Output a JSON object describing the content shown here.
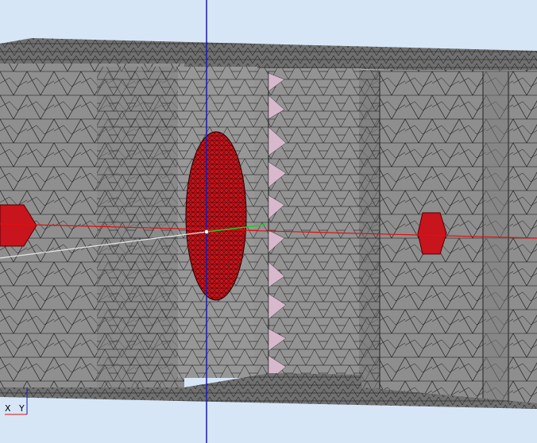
{
  "viewport": {
    "background_color": "#d6e6f7",
    "mesh_face_color": "#8c8c8c",
    "mesh_line_color": "#111111",
    "source_region_color": "#c8141c",
    "tooth_color": "#d8b8cc"
  },
  "axes": {
    "x_axis_color": "#e01010",
    "y_axis_color": "#22cc22",
    "z_axis_color": "#1a1aaa",
    "view_direction_color": "#e8e8e8"
  },
  "orientation_triad": {
    "x_label": "X",
    "y_label": "Y"
  }
}
